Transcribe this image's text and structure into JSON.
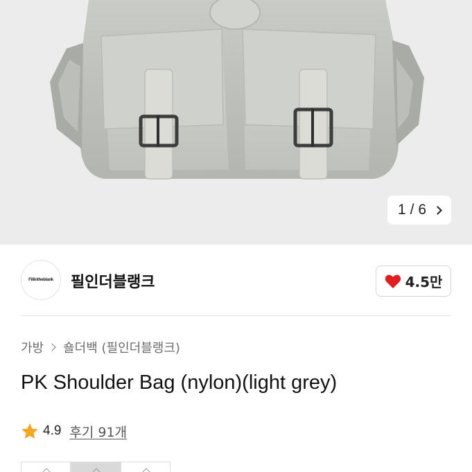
{
  "gallery": {
    "current": "1",
    "separator": "/",
    "total": "6"
  },
  "shop": {
    "logo_text": "Fillintheblank",
    "name": "필인더블랭크",
    "likes": "4.5만",
    "heart_color": "#e02020"
  },
  "product": {
    "breadcrumb": [
      "가방",
      "숄더백 (필인더블랭크)"
    ],
    "title": "PK Shoulder Bag (nylon)(light grey)",
    "rating": "4.9",
    "reviews": "후기 91개",
    "star_color": "#f5a623"
  },
  "icons": {
    "gallery_next": "chevron-right-icon",
    "like": "heart-icon",
    "breadcrumb_sep": "chevron-right-icon",
    "rating": "star-icon"
  }
}
